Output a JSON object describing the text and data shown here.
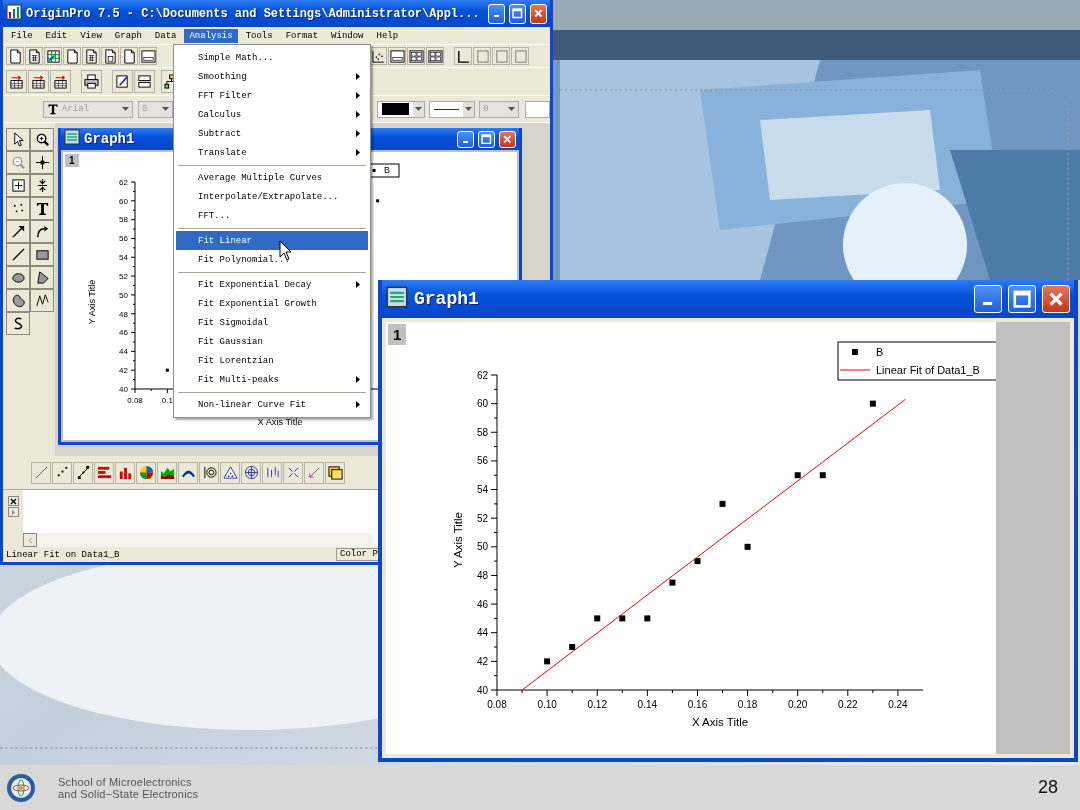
{
  "main_window": {
    "title": "OriginPro 7.5 - C:\\Documents and Settings\\Administrator\\Appl...",
    "menu_bar": [
      {
        "label": "File",
        "selected": false
      },
      {
        "label": "Edit",
        "selected": false
      },
      {
        "label": "View",
        "selected": false
      },
      {
        "label": "Graph",
        "selected": false
      },
      {
        "label": "Data",
        "selected": false
      },
      {
        "label": "Analysis",
        "selected": true
      },
      {
        "label": "Tools",
        "selected": false
      },
      {
        "label": "Format",
        "selected": false
      },
      {
        "label": "Window",
        "selected": false
      },
      {
        "label": "Help",
        "selected": false
      }
    ],
    "format_toolbar": {
      "font_box": {
        "value": "Arial",
        "disabled": true
      },
      "size_box": {
        "value": "0",
        "disabled": true
      },
      "line_width_box": {
        "value": "0",
        "disabled": true
      }
    },
    "graph_window": {
      "title": "Graph1",
      "layer": "1",
      "chart_data": {
        "type": "scatter",
        "xlabel": "X Axis Title",
        "ylabel": "Y Axis Title",
        "xlim": [
          0.08,
          0.25
        ],
        "ylim": [
          40,
          62
        ],
        "xticks": [
          {
            "value": 0.08,
            "label": "0.08"
          },
          {
            "value": 0.1,
            "label": "0.1"
          }
        ],
        "yticks": [
          40,
          42,
          44,
          46,
          48,
          50,
          52,
          54,
          56,
          58,
          60,
          62
        ],
        "x": [
          0.1,
          0.23
        ],
        "series": [
          {
            "name": "B",
            "type": "scatter",
            "color": "#000000",
            "values": [
              42,
              60
            ]
          }
        ],
        "legend": "upper right"
      }
    },
    "status_bar": {
      "message": "Linear Fit on Data1_B",
      "panel": "Color P"
    }
  },
  "analysis_menu": {
    "items": [
      {
        "kind": "item",
        "label": "Simple Math...",
        "submenu": false,
        "selected": false
      },
      {
        "kind": "item",
        "label": "Smoothing",
        "submenu": true,
        "selected": false
      },
      {
        "kind": "item",
        "label": "FFT Filter",
        "submenu": true,
        "selected": false
      },
      {
        "kind": "item",
        "label": "Calculus",
        "submenu": true,
        "selected": false
      },
      {
        "kind": "item",
        "label": "Subtract",
        "submenu": true,
        "selected": false
      },
      {
        "kind": "item",
        "label": "Translate",
        "submenu": true,
        "selected": false
      },
      {
        "kind": "separator"
      },
      {
        "kind": "item",
        "label": "Average Multiple Curves",
        "submenu": false,
        "selected": false
      },
      {
        "kind": "item",
        "label": "Interpolate/Extrapolate...",
        "submenu": false,
        "selected": false
      },
      {
        "kind": "item",
        "label": "FFT...",
        "submenu": false,
        "selected": false
      },
      {
        "kind": "separator"
      },
      {
        "kind": "item",
        "label": "Fit Linear",
        "submenu": false,
        "selected": true
      },
      {
        "kind": "item",
        "label": "Fit Polynomial...",
        "submenu": false,
        "selected": false
      },
      {
        "kind": "separator"
      },
      {
        "kind": "item",
        "label": "Fit Exponential Decay",
        "submenu": true,
        "selected": false
      },
      {
        "kind": "item",
        "label": "Fit Exponential Growth",
        "submenu": false,
        "selected": false
      },
      {
        "kind": "item",
        "label": "Fit Sigmoidal",
        "submenu": false,
        "selected": false
      },
      {
        "kind": "item",
        "label": "Fit Gaussian",
        "submenu": false,
        "selected": false
      },
      {
        "kind": "item",
        "label": "Fit Lorentzian",
        "submenu": false,
        "selected": false
      },
      {
        "kind": "item",
        "label": "Fit Multi-peaks",
        "submenu": true,
        "selected": false
      },
      {
        "kind": "separator"
      },
      {
        "kind": "item",
        "label": "Non-linear Curve Fit",
        "submenu": true,
        "selected": false
      }
    ]
  },
  "graph_window": {
    "title": "Graph1",
    "layer": "1",
    "chart_data": {
      "type": "scatter",
      "xlabel": "X Axis Title",
      "ylabel": "Y Axis Title",
      "xlim": [
        0.08,
        0.25
      ],
      "ylim": [
        40,
        62
      ],
      "xticks": [
        {
          "value": 0.08,
          "label": "0.08"
        },
        {
          "value": 0.1,
          "label": "0.10"
        },
        {
          "value": 0.12,
          "label": "0.12"
        },
        {
          "value": 0.14,
          "label": "0.14"
        },
        {
          "value": 0.16,
          "label": "0.16"
        },
        {
          "value": 0.18,
          "label": "0.18"
        },
        {
          "value": 0.2,
          "label": "0.20"
        },
        {
          "value": 0.22,
          "label": "0.22"
        },
        {
          "value": 0.24,
          "label": "0.24"
        }
      ],
      "yticks": [
        40,
        42,
        44,
        46,
        48,
        50,
        52,
        54,
        56,
        58,
        60,
        62
      ],
      "x": [
        0.09,
        0.1,
        0.11,
        0.12,
        0.13,
        0.14,
        0.15,
        0.16,
        0.17,
        0.18,
        0.2,
        0.21,
        0.23,
        0.243
      ],
      "series": [
        {
          "name": "B",
          "type": "scatter",
          "color": "#000000",
          "values": [
            null,
            42,
            43,
            45,
            45,
            45,
            47.5,
            49,
            53,
            50,
            55,
            55,
            60,
            null
          ]
        },
        {
          "name": "Linear Fit of Data1_B",
          "type": "line",
          "color": "#ff0000",
          "values": [
            40,
            41.33,
            42.66,
            43.98,
            45.31,
            46.64,
            47.97,
            49.29,
            50.62,
            51.95,
            54.6,
            55.93,
            58.58,
            60.3
          ]
        }
      ],
      "legend": "upper right"
    }
  },
  "footer": {
    "school_lines": [
      "School of Microelectronics",
      "and Solid−State Electronics"
    ],
    "page_number": "28"
  }
}
